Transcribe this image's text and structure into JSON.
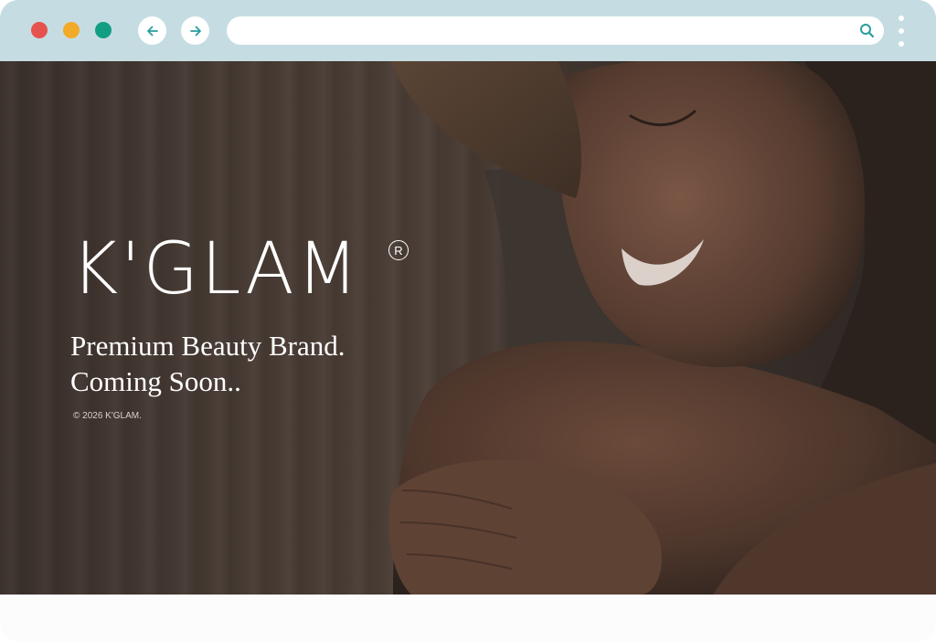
{
  "browser": {
    "window_controls": [
      {
        "name": "close",
        "color": "#e6534c"
      },
      {
        "name": "minimize",
        "color": "#f2aa29"
      },
      {
        "name": "maximize",
        "color": "#129e84"
      }
    ],
    "back_icon": "arrow-left-icon",
    "forward_icon": "arrow-right-icon",
    "address": {
      "value": "",
      "search_icon": "search-icon"
    },
    "menu_icon": "kebab-menu-icon",
    "accent": "#c5dde2",
    "icon_color": "#2a9d9d"
  },
  "page": {
    "brand": "K'GLAM",
    "registered_mark": "R",
    "tagline_line1": "Premium Beauty Brand.",
    "tagline_line2": "Coming Soon..",
    "copyright": "© 2026 K'GLAM."
  }
}
